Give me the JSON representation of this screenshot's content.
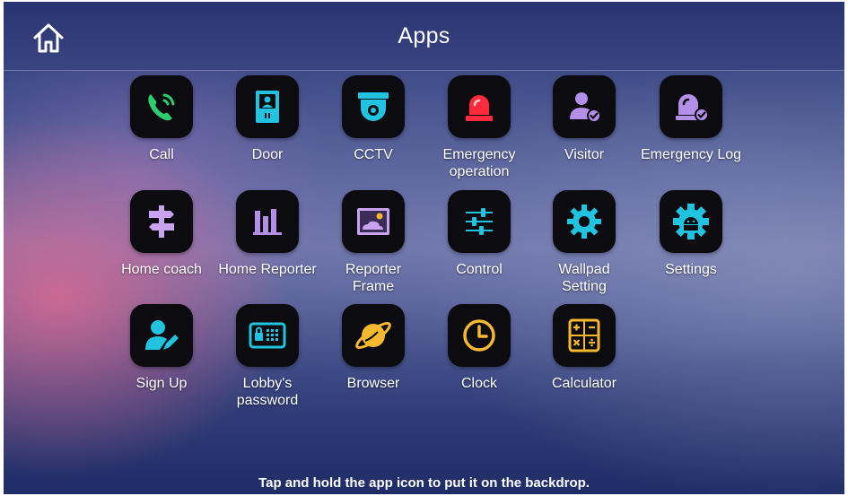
{
  "header": {
    "title": "Apps",
    "home_icon": "home-icon"
  },
  "apps": [
    {
      "label": "Call",
      "icon": "phone-icon",
      "color": "#2ecc71"
    },
    {
      "label": "Door",
      "icon": "door-icon",
      "color": "#20c4e0"
    },
    {
      "label": "CCTV",
      "icon": "cctv-camera-icon",
      "color": "#20c4e0"
    },
    {
      "label": "Emergency\noperation",
      "icon": "emergency-light-icon",
      "color": "#ff2a3c"
    },
    {
      "label": "Visitor",
      "icon": "visitor-icon",
      "color": "#b48fe8"
    },
    {
      "label": "Emergency Log",
      "icon": "emergency-log-icon",
      "color": "#b48fe8"
    },
    {
      "label": "Home coach",
      "icon": "signpost-icon",
      "color": "#c9a2f0"
    },
    {
      "label": "Home Reporter",
      "icon": "bar-chart-icon",
      "color": "#b48fe8"
    },
    {
      "label": "Reporter\nFrame",
      "icon": "picture-frame-icon",
      "color": "#c9a2f0"
    },
    {
      "label": "Control",
      "icon": "sliders-icon",
      "color": "#20c4e0"
    },
    {
      "label": "Wallpad\nSetting",
      "icon": "gear-icon",
      "color": "#20c4e0"
    },
    {
      "label": "Settings",
      "icon": "android-gear-icon",
      "color": "#20c4e0"
    },
    {
      "label": "Sign Up",
      "icon": "sign-up-icon",
      "color": "#20c4e0"
    },
    {
      "label": "Lobby's\npassword",
      "icon": "keypad-lock-icon",
      "color": "#20c4e0"
    },
    {
      "label": "Browser",
      "icon": "planet-icon",
      "color": "#f5b82e"
    },
    {
      "label": "Clock",
      "icon": "clock-icon",
      "color": "#f5b82e"
    },
    {
      "label": "Calculator",
      "icon": "calculator-icon",
      "color": "#f5b82e"
    }
  ],
  "footer": {
    "hint": "Tap and hold the app icon to put it on the backdrop."
  },
  "colors": {
    "tile_background": "#0b0b10",
    "header_background": "#2a3472"
  }
}
